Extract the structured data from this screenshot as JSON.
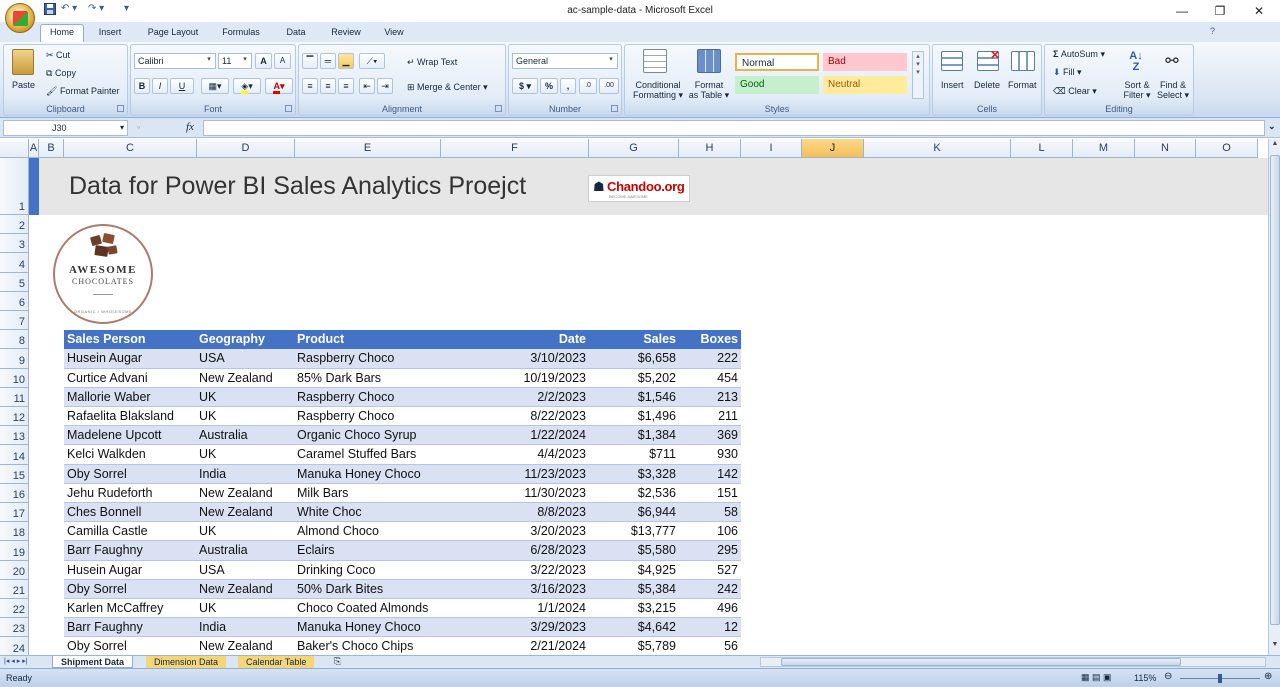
{
  "window": {
    "title": "ac-sample-data - Microsoft Excel",
    "minimize": "—",
    "restore": "❐",
    "close": "✕"
  },
  "qat": {
    "save_icon": "save-icon",
    "undo": "↶ ▾",
    "redo": "↷ ▾",
    "customize": "▾"
  },
  "ribbon_tabs": [
    "Home",
    "Insert",
    "Page Layout",
    "Formulas",
    "Data",
    "Review",
    "View"
  ],
  "ribbon": {
    "clipboard": {
      "paste": "Paste",
      "cut": "Cut",
      "copy": "Copy",
      "format_painter": "Format Painter",
      "label": "Clipboard"
    },
    "font": {
      "name": "Calibri",
      "size": "11",
      "bold": "B",
      "italic": "I",
      "underline": "U",
      "grow": "A",
      "shrink": "A",
      "label": "Font"
    },
    "alignment": {
      "wrap": "Wrap Text",
      "merge": "Merge & Center",
      "label": "Alignment"
    },
    "number": {
      "format": "General",
      "currency": "$",
      "percent": "%",
      "comma": ",",
      "inc": ".0",
      "dec": ".00",
      "label": "Number"
    },
    "styles": {
      "conditional": "Conditional",
      "conditional2": "Formatting",
      "format_table": "Format",
      "format_table2": "as Table",
      "normal": "Normal",
      "bad": "Bad",
      "good": "Good",
      "neutral": "Neutral",
      "label": "Styles",
      "colors": {
        "normal_bg": "#ffffff",
        "bad_bg": "#ffc7ce",
        "bad_fg": "#9c0006",
        "good_bg": "#c6efce",
        "good_fg": "#006100",
        "neutral_bg": "#ffeb9c",
        "neutral_fg": "#9c5700"
      }
    },
    "cells": {
      "insert": "Insert",
      "delete": "Delete",
      "format": "Format",
      "label": "Cells"
    },
    "editing": {
      "autosum": "AutoSum",
      "fill": "Fill",
      "clear": "Clear",
      "sort": "Sort &",
      "sort2": "Filter",
      "find": "Find &",
      "find2": "Select",
      "label": "Editing"
    }
  },
  "formula_bar": {
    "name_box": "J30",
    "fx": "fx",
    "formula": ""
  },
  "columns": [
    "A",
    "B",
    "C",
    "D",
    "E",
    "F",
    "G",
    "H",
    "I",
    "J",
    "K",
    "L",
    "M",
    "N",
    "O"
  ],
  "selected_column": "J",
  "rows": [
    "1",
    "2",
    "3",
    "4",
    "5",
    "6",
    "7",
    "8",
    "9",
    "10",
    "11",
    "12",
    "13",
    "14",
    "15",
    "16",
    "17",
    "18",
    "19",
    "20",
    "21",
    "22",
    "23",
    "24"
  ],
  "sheet": {
    "title": "Data for Power BI Sales Analytics Proejct",
    "chandoo_logo": "Chandoo.org",
    "chandoo_tag": "BECOME AWESOME",
    "logo_line1": "AWESOME",
    "logo_line2": "CHOCOLATES",
    "logo_ring": "ORGANIC • WHOLESOME",
    "header_bg": "#4472c4",
    "band_bg": "#d9e1f2",
    "table_headers": [
      "Sales Person",
      "Geography",
      "Product",
      "Date",
      "Sales",
      "Boxes"
    ],
    "table_rows": [
      [
        "Husein Augar",
        "USA",
        "Raspberry Choco",
        "3/10/2023",
        "$6,658",
        "222"
      ],
      [
        "Curtice Advani",
        "New Zealand",
        "85% Dark Bars",
        "10/19/2023",
        "$5,202",
        "454"
      ],
      [
        "Mallorie Waber",
        "UK",
        "Raspberry Choco",
        "2/2/2023",
        "$1,546",
        "213"
      ],
      [
        "Rafaelita Blaksland",
        "UK",
        "Raspberry Choco",
        "8/22/2023",
        "$1,496",
        "211"
      ],
      [
        "Madelene Upcott",
        "Australia",
        "Organic Choco Syrup",
        "1/22/2024",
        "$1,384",
        "369"
      ],
      [
        "Kelci Walkden",
        "UK",
        "Caramel Stuffed Bars",
        "4/4/2023",
        "$711",
        "930"
      ],
      [
        "Oby Sorrel",
        "India",
        "Manuka Honey Choco",
        "11/23/2023",
        "$3,328",
        "142"
      ],
      [
        "Jehu Rudeforth",
        "New Zealand",
        "Milk Bars",
        "11/30/2023",
        "$2,536",
        "151"
      ],
      [
        "Ches Bonnell",
        "New Zealand",
        "White Choc",
        "8/8/2023",
        "$6,944",
        "58"
      ],
      [
        "Camilla Castle",
        "UK",
        "Almond Choco",
        "3/20/2023",
        "$13,777",
        "106"
      ],
      [
        "Barr Faughny",
        "Australia",
        "Eclairs",
        "6/28/2023",
        "$5,580",
        "295"
      ],
      [
        "Husein Augar",
        "USA",
        "Drinking Coco",
        "3/22/2023",
        "$4,925",
        "527"
      ],
      [
        "Oby Sorrel",
        "New Zealand",
        "50% Dark Bites",
        "3/16/2023",
        "$5,384",
        "242"
      ],
      [
        "Karlen McCaffrey",
        "UK",
        "Choco Coated Almonds",
        "1/1/2024",
        "$3,215",
        "496"
      ],
      [
        "Barr Faughny",
        "India",
        "Manuka Honey Choco",
        "3/29/2023",
        "$4,642",
        "12"
      ],
      [
        "Oby Sorrel",
        "New Zealand",
        "Baker's Choco Chips",
        "2/21/2024",
        "$5,789",
        "56"
      ]
    ]
  },
  "sheet_tabs": [
    "Shipment Data",
    "Dimension Data",
    "Calendar Table"
  ],
  "active_sheet": "Shipment Data",
  "status": {
    "ready": "Ready",
    "zoom": "115%"
  }
}
